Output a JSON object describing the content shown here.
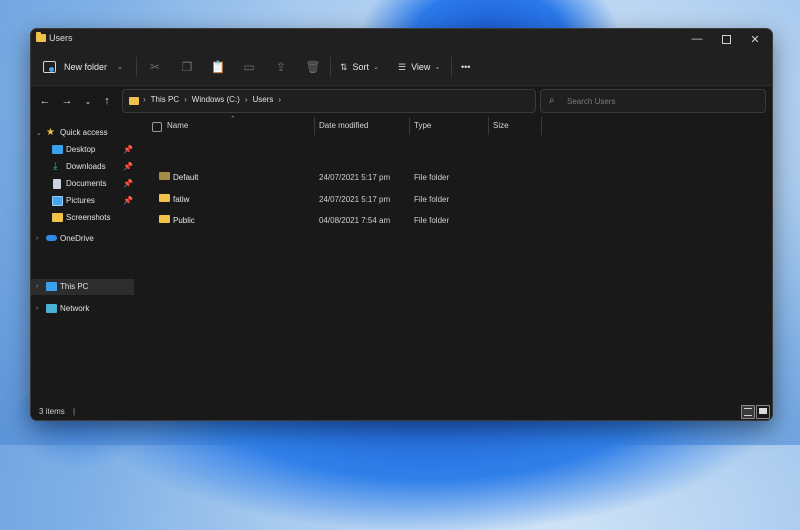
{
  "window": {
    "title": "Users"
  },
  "toolbar": {
    "new_folder_label": "New folder",
    "sort_label": "Sort",
    "view_label": "View",
    "more_label": "•••",
    "icons": [
      "cut-icon",
      "copy-icon",
      "paste-icon",
      "rename-icon",
      "share-icon",
      "delete-icon"
    ]
  },
  "address": {
    "crumbs": [
      "This PC",
      "Windows (C:)",
      "Users"
    ]
  },
  "search": {
    "placeholder": "Search Users"
  },
  "sidebar": {
    "quick_access": "Quick access",
    "items": [
      {
        "label": "Desktop",
        "icon": "desktop-icon",
        "color": "#3aa0f0",
        "pinned": true
      },
      {
        "label": "Downloads",
        "icon": "downloads-icon",
        "color": "#3fb3a0",
        "pinned": true
      },
      {
        "label": "Documents",
        "icon": "documents-icon",
        "color": "#c9d4e0",
        "pinned": true
      },
      {
        "label": "Pictures",
        "icon": "pictures-icon",
        "color": "#45a6ef",
        "pinned": true
      },
      {
        "label": "Screenshots",
        "icon": "folder-icon",
        "color": "#f0c24a",
        "pinned": false
      }
    ],
    "onedrive": "OneDrive",
    "this_pc": "This PC",
    "network": "Network"
  },
  "columns": {
    "name": "Name",
    "date": "Date modified",
    "type": "Type",
    "size": "Size"
  },
  "files": [
    {
      "name": "Default",
      "date": "24/07/2021 5:17 pm",
      "type": "File folder"
    },
    {
      "name": "fatiw",
      "date": "24/07/2021 5:17 pm",
      "type": "File folder"
    },
    {
      "name": "Public",
      "date": "04/08/2021 7:54 am",
      "type": "File folder"
    }
  ],
  "status": {
    "count": "3 items",
    "separator": "|"
  },
  "colors": {
    "folder": "#f0c24a",
    "accent": "#4aa3f0"
  }
}
